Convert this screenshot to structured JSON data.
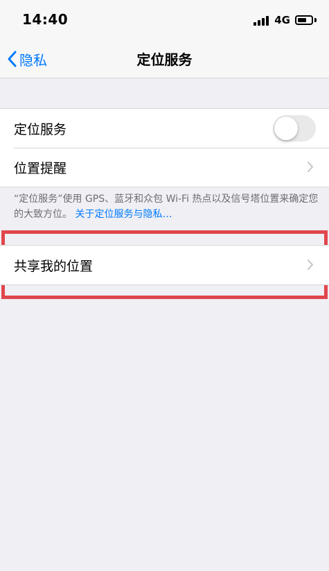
{
  "status_bar": {
    "time": "14:40",
    "network": "4G",
    "signal_bars": 4,
    "battery_level": 0.65
  },
  "nav": {
    "back_label": "隐私",
    "title": "定位服务"
  },
  "settings_group_1": {
    "location_services": {
      "label": "定位服务",
      "toggle_on": false
    },
    "location_alerts": {
      "label": "位置提醒"
    }
  },
  "footer": {
    "text": "“定位服务”使用 GPS、蓝牙和众包 Wi-Fi 热点以及信号塔位置来确定您的大致方位。",
    "link": "关于定位服务与隐私…"
  },
  "settings_group_2": {
    "share_my_location": {
      "label": "共享我的位置"
    }
  },
  "colors": {
    "accent": "#007aff",
    "highlight_border": "#e0464c",
    "background": "#efeff4",
    "toggle_off": "#e9e9ea"
  }
}
